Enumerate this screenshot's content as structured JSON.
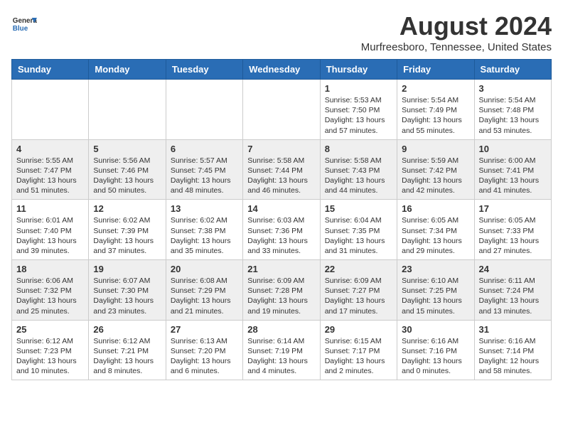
{
  "header": {
    "logo_general": "General",
    "logo_blue": "Blue",
    "month_title": "August 2024",
    "location": "Murfreesboro, Tennessee, United States"
  },
  "days_of_week": [
    "Sunday",
    "Monday",
    "Tuesday",
    "Wednesday",
    "Thursday",
    "Friday",
    "Saturday"
  ],
  "weeks": [
    [
      {
        "day": "",
        "info": ""
      },
      {
        "day": "",
        "info": ""
      },
      {
        "day": "",
        "info": ""
      },
      {
        "day": "",
        "info": ""
      },
      {
        "day": "1",
        "info": "Sunrise: 5:53 AM\nSunset: 7:50 PM\nDaylight: 13 hours and 57 minutes."
      },
      {
        "day": "2",
        "info": "Sunrise: 5:54 AM\nSunset: 7:49 PM\nDaylight: 13 hours and 55 minutes."
      },
      {
        "day": "3",
        "info": "Sunrise: 5:54 AM\nSunset: 7:48 PM\nDaylight: 13 hours and 53 minutes."
      }
    ],
    [
      {
        "day": "4",
        "info": "Sunrise: 5:55 AM\nSunset: 7:47 PM\nDaylight: 13 hours and 51 minutes."
      },
      {
        "day": "5",
        "info": "Sunrise: 5:56 AM\nSunset: 7:46 PM\nDaylight: 13 hours and 50 minutes."
      },
      {
        "day": "6",
        "info": "Sunrise: 5:57 AM\nSunset: 7:45 PM\nDaylight: 13 hours and 48 minutes."
      },
      {
        "day": "7",
        "info": "Sunrise: 5:58 AM\nSunset: 7:44 PM\nDaylight: 13 hours and 46 minutes."
      },
      {
        "day": "8",
        "info": "Sunrise: 5:58 AM\nSunset: 7:43 PM\nDaylight: 13 hours and 44 minutes."
      },
      {
        "day": "9",
        "info": "Sunrise: 5:59 AM\nSunset: 7:42 PM\nDaylight: 13 hours and 42 minutes."
      },
      {
        "day": "10",
        "info": "Sunrise: 6:00 AM\nSunset: 7:41 PM\nDaylight: 13 hours and 41 minutes."
      }
    ],
    [
      {
        "day": "11",
        "info": "Sunrise: 6:01 AM\nSunset: 7:40 PM\nDaylight: 13 hours and 39 minutes."
      },
      {
        "day": "12",
        "info": "Sunrise: 6:02 AM\nSunset: 7:39 PM\nDaylight: 13 hours and 37 minutes."
      },
      {
        "day": "13",
        "info": "Sunrise: 6:02 AM\nSunset: 7:38 PM\nDaylight: 13 hours and 35 minutes."
      },
      {
        "day": "14",
        "info": "Sunrise: 6:03 AM\nSunset: 7:36 PM\nDaylight: 13 hours and 33 minutes."
      },
      {
        "day": "15",
        "info": "Sunrise: 6:04 AM\nSunset: 7:35 PM\nDaylight: 13 hours and 31 minutes."
      },
      {
        "day": "16",
        "info": "Sunrise: 6:05 AM\nSunset: 7:34 PM\nDaylight: 13 hours and 29 minutes."
      },
      {
        "day": "17",
        "info": "Sunrise: 6:05 AM\nSunset: 7:33 PM\nDaylight: 13 hours and 27 minutes."
      }
    ],
    [
      {
        "day": "18",
        "info": "Sunrise: 6:06 AM\nSunset: 7:32 PM\nDaylight: 13 hours and 25 minutes."
      },
      {
        "day": "19",
        "info": "Sunrise: 6:07 AM\nSunset: 7:30 PM\nDaylight: 13 hours and 23 minutes."
      },
      {
        "day": "20",
        "info": "Sunrise: 6:08 AM\nSunset: 7:29 PM\nDaylight: 13 hours and 21 minutes."
      },
      {
        "day": "21",
        "info": "Sunrise: 6:09 AM\nSunset: 7:28 PM\nDaylight: 13 hours and 19 minutes."
      },
      {
        "day": "22",
        "info": "Sunrise: 6:09 AM\nSunset: 7:27 PM\nDaylight: 13 hours and 17 minutes."
      },
      {
        "day": "23",
        "info": "Sunrise: 6:10 AM\nSunset: 7:25 PM\nDaylight: 13 hours and 15 minutes."
      },
      {
        "day": "24",
        "info": "Sunrise: 6:11 AM\nSunset: 7:24 PM\nDaylight: 13 hours and 13 minutes."
      }
    ],
    [
      {
        "day": "25",
        "info": "Sunrise: 6:12 AM\nSunset: 7:23 PM\nDaylight: 13 hours and 10 minutes."
      },
      {
        "day": "26",
        "info": "Sunrise: 6:12 AM\nSunset: 7:21 PM\nDaylight: 13 hours and 8 minutes."
      },
      {
        "day": "27",
        "info": "Sunrise: 6:13 AM\nSunset: 7:20 PM\nDaylight: 13 hours and 6 minutes."
      },
      {
        "day": "28",
        "info": "Sunrise: 6:14 AM\nSunset: 7:19 PM\nDaylight: 13 hours and 4 minutes."
      },
      {
        "day": "29",
        "info": "Sunrise: 6:15 AM\nSunset: 7:17 PM\nDaylight: 13 hours and 2 minutes."
      },
      {
        "day": "30",
        "info": "Sunrise: 6:16 AM\nSunset: 7:16 PM\nDaylight: 13 hours and 0 minutes."
      },
      {
        "day": "31",
        "info": "Sunrise: 6:16 AM\nSunset: 7:14 PM\nDaylight: 12 hours and 58 minutes."
      }
    ]
  ]
}
